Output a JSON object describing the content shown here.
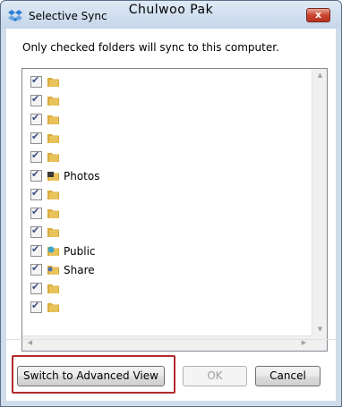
{
  "window": {
    "title": "Selective Sync",
    "user_name": "Chulwoo Pak",
    "close_label": "x",
    "app_icon": "dropbox-icon"
  },
  "instructions": "Only checked folders will sync to this computer.",
  "folders": [
    {
      "label": "",
      "checked": true,
      "icon": "folder-icon"
    },
    {
      "label": "",
      "checked": true,
      "icon": "folder-icon"
    },
    {
      "label": "",
      "checked": true,
      "icon": "folder-icon"
    },
    {
      "label": "",
      "checked": true,
      "icon": "folder-icon"
    },
    {
      "label": "",
      "checked": true,
      "icon": "folder-icon"
    },
    {
      "label": "Photos",
      "checked": true,
      "icon": "photos-folder-icon"
    },
    {
      "label": "",
      "checked": true,
      "icon": "folder-icon"
    },
    {
      "label": "",
      "checked": true,
      "icon": "folder-icon"
    },
    {
      "label": "",
      "checked": true,
      "icon": "folder-icon"
    },
    {
      "label": "Public",
      "checked": true,
      "icon": "public-folder-icon"
    },
    {
      "label": "Share",
      "checked": true,
      "icon": "shared-folder-icon"
    },
    {
      "label": "",
      "checked": true,
      "icon": "folder-icon"
    },
    {
      "label": "",
      "checked": true,
      "icon": "folder-icon"
    }
  ],
  "buttons": {
    "advanced": "Switch to Advanced View",
    "ok": "OK",
    "cancel": "Cancel"
  },
  "colors": {
    "highlight": "#b22a2a",
    "folder": "#e8c25a"
  }
}
